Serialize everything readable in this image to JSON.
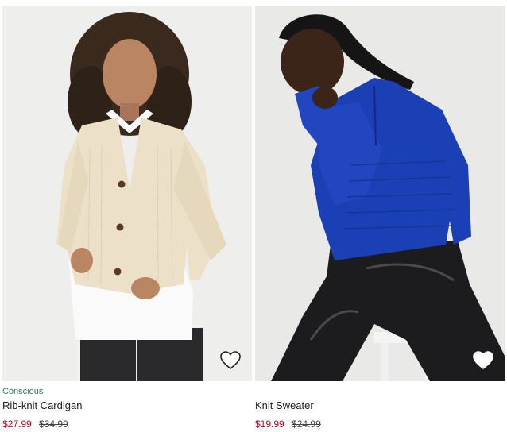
{
  "products": [
    {
      "badge": "Conscious",
      "name": "Rib-knit Cardigan",
      "sale_price": "$27.99",
      "original_price": "$34.99",
      "favorite": false,
      "favorite_icon": "heart-outline-icon"
    },
    {
      "badge": "",
      "name": "Knit Sweater",
      "sale_price": "$19.99",
      "original_price": "$24.99",
      "favorite": false,
      "favorite_icon": "heart-outline-icon"
    }
  ],
  "colors": {
    "sale_price": "#d0021b",
    "conscious_badge": "#2e7d4f",
    "cardigan": "#ece0c9",
    "sweater": "#1b3fb5",
    "photo_background": "#eeeeec"
  }
}
